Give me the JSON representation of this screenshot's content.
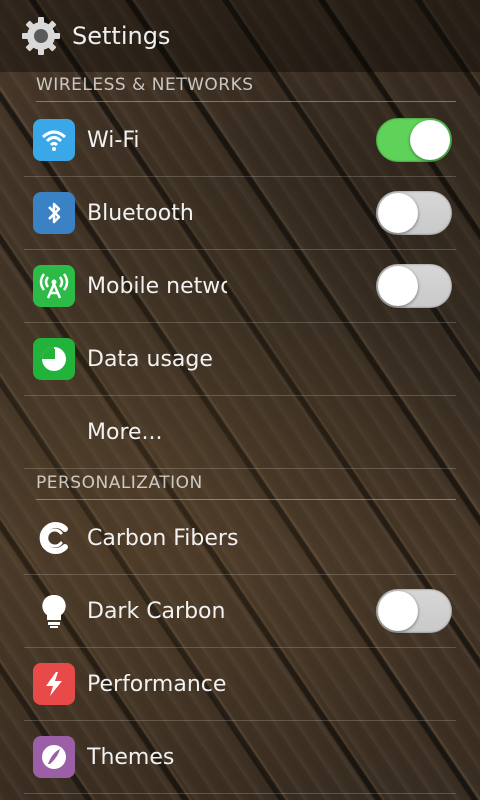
{
  "header": {
    "title": "Settings",
    "icon": "gear-icon"
  },
  "sections": [
    {
      "title": "WIRELESS & NETWORKS"
    },
    {
      "title": "PERSONALIZATION"
    }
  ],
  "wireless": [
    {
      "label": "Wi-Fi",
      "icon": "wifi-icon",
      "icon_color": "#3aa7e8",
      "toggle": true,
      "enabled": true
    },
    {
      "label": "Bluetooth",
      "icon": "bluetooth-icon",
      "icon_color": "#3b82c4",
      "toggle": true,
      "enabled": false
    },
    {
      "label": "Mobile networks",
      "icon": "signal-tower-icon",
      "icon_color": "#2dbb47",
      "toggle": true,
      "enabled": false
    },
    {
      "label": "Data usage",
      "icon": "pie-chart-icon",
      "icon_color": "#22b33a",
      "toggle": false
    },
    {
      "label": "More...",
      "icon": "",
      "toggle": false
    }
  ],
  "personalization": [
    {
      "label": "Carbon Fibers",
      "icon": "carbon-logo-icon",
      "toggle": false
    },
    {
      "label": "Dark Carbon",
      "icon": "lightbulb-icon",
      "toggle": true,
      "enabled": false
    },
    {
      "label": "Performance",
      "icon": "lightning-icon",
      "icon_color": "#e84a4a",
      "toggle": false
    },
    {
      "label": "Themes",
      "icon": "theme-brush-icon",
      "icon_color": "#9b5fa8",
      "toggle": false
    }
  ]
}
